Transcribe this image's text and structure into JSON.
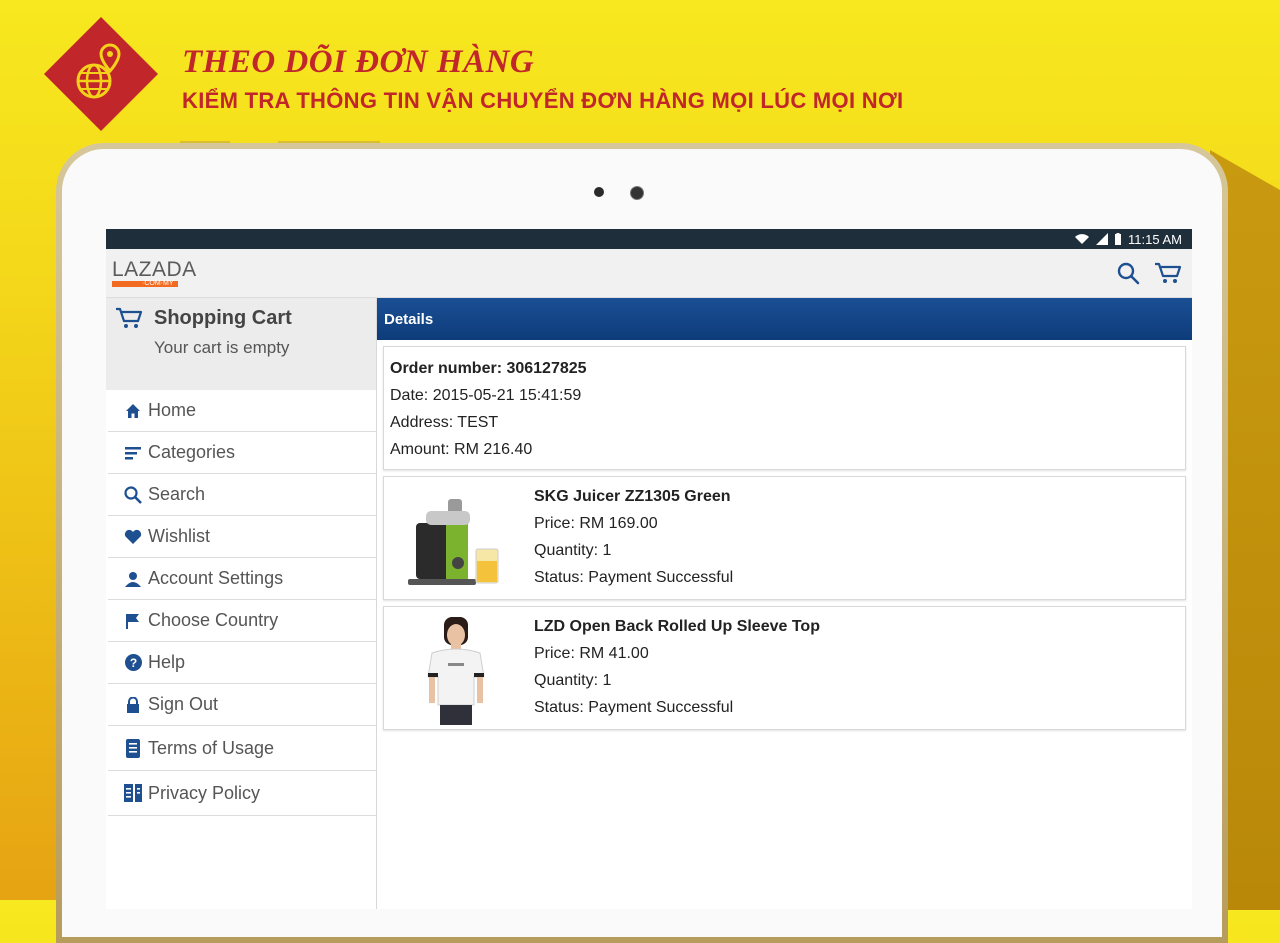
{
  "promo": {
    "title": "THEO DÕI ĐƠN HÀNG",
    "subtitle": "KIỂM TRA THÔNG TIN VẬN CHUYỂN ĐƠN HÀNG MỌI LÚC MỌI NƠI"
  },
  "statusbar": {
    "time": "11:15 AM"
  },
  "appbar": {
    "logo": "LAZADA",
    "logo_sub": "·COM·MY"
  },
  "drawer": {
    "cart_title": "Shopping Cart",
    "cart_status": "Your cart is empty",
    "items": [
      {
        "label": "Home",
        "icon": "home-icon"
      },
      {
        "label": "Categories",
        "icon": "categories-icon"
      },
      {
        "label": "Search",
        "icon": "search-icon"
      },
      {
        "label": "Wishlist",
        "icon": "heart-icon"
      },
      {
        "label": "Account Settings",
        "icon": "user-icon"
      },
      {
        "label": "Choose Country",
        "icon": "flag-icon"
      },
      {
        "label": "Help",
        "icon": "help-icon"
      },
      {
        "label": "Sign Out",
        "icon": "lock-icon"
      },
      {
        "label": "Terms of Usage",
        "icon": "document-icon"
      },
      {
        "label": "Privacy Policy",
        "icon": "policy-icon"
      }
    ]
  },
  "details": {
    "header": "Details",
    "order": {
      "number": "Order number: 306127825",
      "date": "Date: 2015-05-21 15:41:59",
      "address": "Address: TEST",
      "amount": "Amount: RM 216.40"
    },
    "items": [
      {
        "name": "SKG Juicer ZZ1305 Green",
        "price": "Price: RM 169.00",
        "quantity": "Quantity: 1",
        "status": "Status: Payment Successful"
      },
      {
        "name": "LZD Open Back Rolled Up Sleeve Top",
        "price": "Price: RM 41.00",
        "quantity": "Quantity: 1",
        "status": "Status: Payment Successful"
      }
    ]
  },
  "colors": {
    "promo_red": "#c0262a",
    "header_blue": "#0e3c7a",
    "lazada_orange": "#f26b21",
    "icon_blue": "#1d4f91"
  }
}
